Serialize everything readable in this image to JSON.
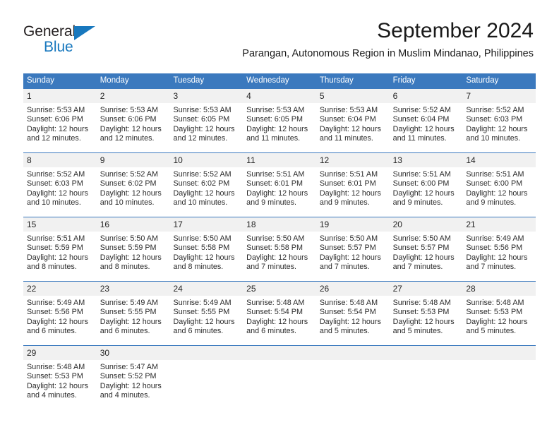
{
  "branding": {
    "logo_primary": "General",
    "logo_secondary": "Blue",
    "primary_color": "#231f20",
    "accent_color": "#1878be"
  },
  "header": {
    "title": "September 2024",
    "subtitle": "Parangan, Autonomous Region in Muslim Mindanao, Philippines"
  },
  "calendar": {
    "header_bg_color": "#3b79be",
    "daynum_bg_color": "#f1f1f1",
    "weekdays": [
      "Sunday",
      "Monday",
      "Tuesday",
      "Wednesday",
      "Thursday",
      "Friday",
      "Saturday"
    ],
    "weeks": [
      {
        "days": [
          {
            "num": "1",
            "lines": [
              "Sunrise: 5:53 AM",
              "Sunset: 6:06 PM",
              "Daylight: 12 hours",
              "and 12 minutes."
            ]
          },
          {
            "num": "2",
            "lines": [
              "Sunrise: 5:53 AM",
              "Sunset: 6:06 PM",
              "Daylight: 12 hours",
              "and 12 minutes."
            ]
          },
          {
            "num": "3",
            "lines": [
              "Sunrise: 5:53 AM",
              "Sunset: 6:05 PM",
              "Daylight: 12 hours",
              "and 12 minutes."
            ]
          },
          {
            "num": "4",
            "lines": [
              "Sunrise: 5:53 AM",
              "Sunset: 6:05 PM",
              "Daylight: 12 hours",
              "and 11 minutes."
            ]
          },
          {
            "num": "5",
            "lines": [
              "Sunrise: 5:53 AM",
              "Sunset: 6:04 PM",
              "Daylight: 12 hours",
              "and 11 minutes."
            ]
          },
          {
            "num": "6",
            "lines": [
              "Sunrise: 5:52 AM",
              "Sunset: 6:04 PM",
              "Daylight: 12 hours",
              "and 11 minutes."
            ]
          },
          {
            "num": "7",
            "lines": [
              "Sunrise: 5:52 AM",
              "Sunset: 6:03 PM",
              "Daylight: 12 hours",
              "and 10 minutes."
            ]
          }
        ]
      },
      {
        "days": [
          {
            "num": "8",
            "lines": [
              "Sunrise: 5:52 AM",
              "Sunset: 6:03 PM",
              "Daylight: 12 hours",
              "and 10 minutes."
            ]
          },
          {
            "num": "9",
            "lines": [
              "Sunrise: 5:52 AM",
              "Sunset: 6:02 PM",
              "Daylight: 12 hours",
              "and 10 minutes."
            ]
          },
          {
            "num": "10",
            "lines": [
              "Sunrise: 5:52 AM",
              "Sunset: 6:02 PM",
              "Daylight: 12 hours",
              "and 10 minutes."
            ]
          },
          {
            "num": "11",
            "lines": [
              "Sunrise: 5:51 AM",
              "Sunset: 6:01 PM",
              "Daylight: 12 hours",
              "and 9 minutes."
            ]
          },
          {
            "num": "12",
            "lines": [
              "Sunrise: 5:51 AM",
              "Sunset: 6:01 PM",
              "Daylight: 12 hours",
              "and 9 minutes."
            ]
          },
          {
            "num": "13",
            "lines": [
              "Sunrise: 5:51 AM",
              "Sunset: 6:00 PM",
              "Daylight: 12 hours",
              "and 9 minutes."
            ]
          },
          {
            "num": "14",
            "lines": [
              "Sunrise: 5:51 AM",
              "Sunset: 6:00 PM",
              "Daylight: 12 hours",
              "and 9 minutes."
            ]
          }
        ]
      },
      {
        "days": [
          {
            "num": "15",
            "lines": [
              "Sunrise: 5:51 AM",
              "Sunset: 5:59 PM",
              "Daylight: 12 hours",
              "and 8 minutes."
            ]
          },
          {
            "num": "16",
            "lines": [
              "Sunrise: 5:50 AM",
              "Sunset: 5:59 PM",
              "Daylight: 12 hours",
              "and 8 minutes."
            ]
          },
          {
            "num": "17",
            "lines": [
              "Sunrise: 5:50 AM",
              "Sunset: 5:58 PM",
              "Daylight: 12 hours",
              "and 8 minutes."
            ]
          },
          {
            "num": "18",
            "lines": [
              "Sunrise: 5:50 AM",
              "Sunset: 5:58 PM",
              "Daylight: 12 hours",
              "and 7 minutes."
            ]
          },
          {
            "num": "19",
            "lines": [
              "Sunrise: 5:50 AM",
              "Sunset: 5:57 PM",
              "Daylight: 12 hours",
              "and 7 minutes."
            ]
          },
          {
            "num": "20",
            "lines": [
              "Sunrise: 5:50 AM",
              "Sunset: 5:57 PM",
              "Daylight: 12 hours",
              "and 7 minutes."
            ]
          },
          {
            "num": "21",
            "lines": [
              "Sunrise: 5:49 AM",
              "Sunset: 5:56 PM",
              "Daylight: 12 hours",
              "and 7 minutes."
            ]
          }
        ]
      },
      {
        "days": [
          {
            "num": "22",
            "lines": [
              "Sunrise: 5:49 AM",
              "Sunset: 5:56 PM",
              "Daylight: 12 hours",
              "and 6 minutes."
            ]
          },
          {
            "num": "23",
            "lines": [
              "Sunrise: 5:49 AM",
              "Sunset: 5:55 PM",
              "Daylight: 12 hours",
              "and 6 minutes."
            ]
          },
          {
            "num": "24",
            "lines": [
              "Sunrise: 5:49 AM",
              "Sunset: 5:55 PM",
              "Daylight: 12 hours",
              "and 6 minutes."
            ]
          },
          {
            "num": "25",
            "lines": [
              "Sunrise: 5:48 AM",
              "Sunset: 5:54 PM",
              "Daylight: 12 hours",
              "and 6 minutes."
            ]
          },
          {
            "num": "26",
            "lines": [
              "Sunrise: 5:48 AM",
              "Sunset: 5:54 PM",
              "Daylight: 12 hours",
              "and 5 minutes."
            ]
          },
          {
            "num": "27",
            "lines": [
              "Sunrise: 5:48 AM",
              "Sunset: 5:53 PM",
              "Daylight: 12 hours",
              "and 5 minutes."
            ]
          },
          {
            "num": "28",
            "lines": [
              "Sunrise: 5:48 AM",
              "Sunset: 5:53 PM",
              "Daylight: 12 hours",
              "and 5 minutes."
            ]
          }
        ]
      },
      {
        "days": [
          {
            "num": "29",
            "lines": [
              "Sunrise: 5:48 AM",
              "Sunset: 5:53 PM",
              "Daylight: 12 hours",
              "and 4 minutes."
            ]
          },
          {
            "num": "30",
            "lines": [
              "Sunrise: 5:47 AM",
              "Sunset: 5:52 PM",
              "Daylight: 12 hours",
              "and 4 minutes."
            ]
          },
          {
            "num": "",
            "lines": []
          },
          {
            "num": "",
            "lines": []
          },
          {
            "num": "",
            "lines": []
          },
          {
            "num": "",
            "lines": []
          },
          {
            "num": "",
            "lines": []
          }
        ]
      }
    ]
  }
}
